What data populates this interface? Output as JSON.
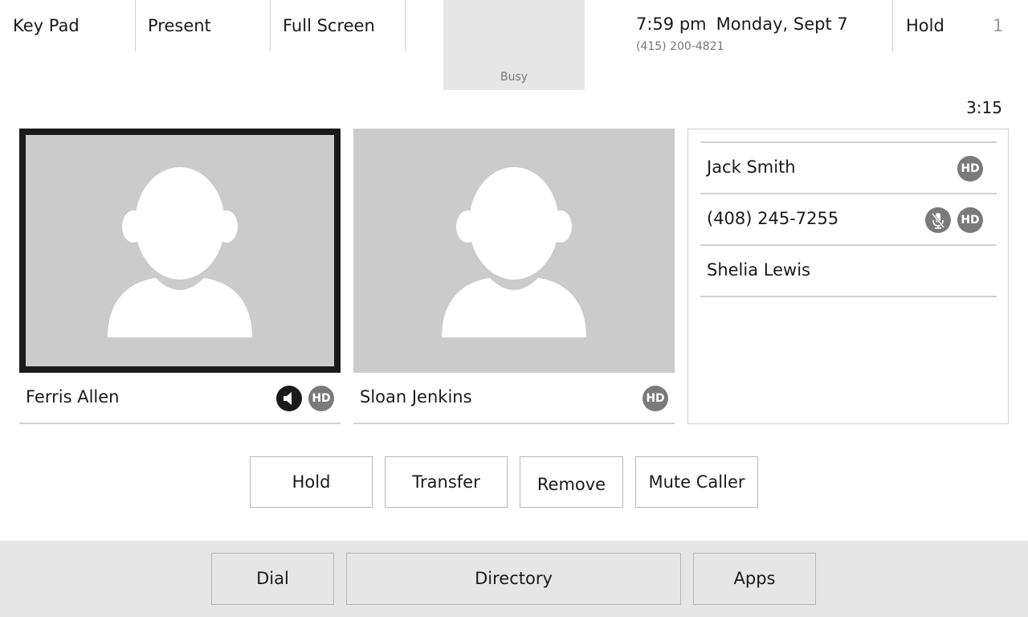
{
  "top_bar": {
    "tabs": [
      "Key Pad",
      "Present",
      "Full Screen"
    ],
    "self_view_status": "Busy",
    "time": "7:59 pm",
    "date": "Monday, Sept 7",
    "own_number": "(415) 200-4821",
    "hold_label": "Hold",
    "hold_count": "1"
  },
  "call": {
    "timer": "3:15"
  },
  "video_tiles": [
    {
      "name": "Ferris Allen",
      "active": true,
      "speaking": true,
      "hd": "HD"
    },
    {
      "name": "Sloan Jenkins",
      "active": false,
      "speaking": false,
      "hd": "HD"
    }
  ],
  "participants": [
    {
      "name": "Jack Smith",
      "hd": "HD",
      "muted": false
    },
    {
      "name": "(408) 245-7255",
      "hd": "HD",
      "muted": true
    },
    {
      "name": "Shelia Lewis",
      "hd": "",
      "muted": false
    }
  ],
  "actions": [
    "Hold",
    "Transfer",
    "Remove",
    "Mute Caller"
  ],
  "bottom_nav": [
    "Dial",
    "Directory",
    "Apps"
  ],
  "icons": {
    "speaker": "speaker-icon",
    "mic_muted": "mic-muted-icon",
    "avatar": "person-silhouette-icon"
  },
  "colors": {
    "tile_bg": "#cbcbcb",
    "badge": "#7a7a7a",
    "active_border": "#1a1a1a",
    "bottom_bar": "#e6e6e6"
  }
}
